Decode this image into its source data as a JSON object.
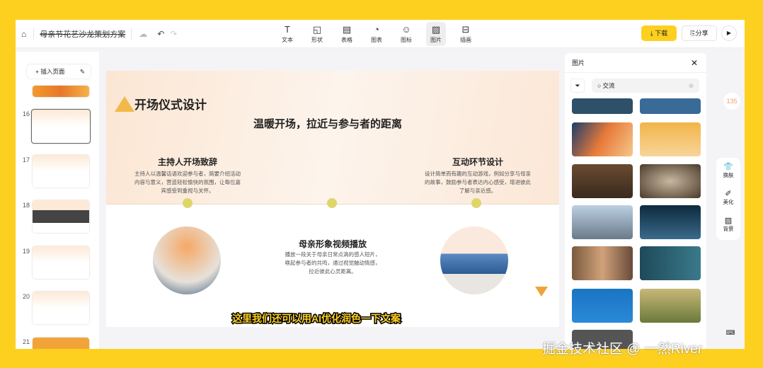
{
  "topbar": {
    "title": "母亲节花艺沙龙策划方案",
    "tools": [
      {
        "label": "文本",
        "icon": "T"
      },
      {
        "label": "形状",
        "icon": "◱"
      },
      {
        "label": "表格",
        "icon": "▤"
      },
      {
        "label": "图表",
        "icon": "◔"
      },
      {
        "label": "图标",
        "icon": "☺"
      },
      {
        "label": "图片",
        "icon": "▨"
      },
      {
        "label": "插画",
        "icon": "⊟"
      }
    ],
    "download": "下载",
    "share": "分享"
  },
  "sidebar": {
    "insert": "+ 插入页面",
    "pages": [
      "16",
      "17",
      "18",
      "19",
      "20",
      "21"
    ]
  },
  "slide": {
    "title": "开场仪式设计",
    "subtitle": "温暖开场，拉近与参与者的距离",
    "s1": {
      "h": "主持人开场致辞",
      "p": "主持人以温馨话语欢迎参与者，简要介绍活动内容与意义，营造轻松愉快的氛围，让每位嘉宾感受到重视与关怀。"
    },
    "s2": {
      "h": "互动环节设计",
      "p": "设计简单而有趣的互动游戏，例如分享与母亲的故事，鼓励参与者表达内心感受，增进彼此了解与亲近感。"
    },
    "s3": {
      "h": "母亲形象视频播放",
      "p": "播放一段关于母亲日常点滴的感人短片，唤起参与者的共鸣，通过视觉触动情感，拉近彼此心灵距离。"
    }
  },
  "panel": {
    "title": "图片",
    "query": "交流"
  },
  "right": {
    "version": "135",
    "skin": "换肤",
    "beautify": "美化",
    "background": "背景"
  },
  "caption": "这里我们还可以用AI优化润色一下文案",
  "watermark": "掘金技术社区 @ 一然River"
}
